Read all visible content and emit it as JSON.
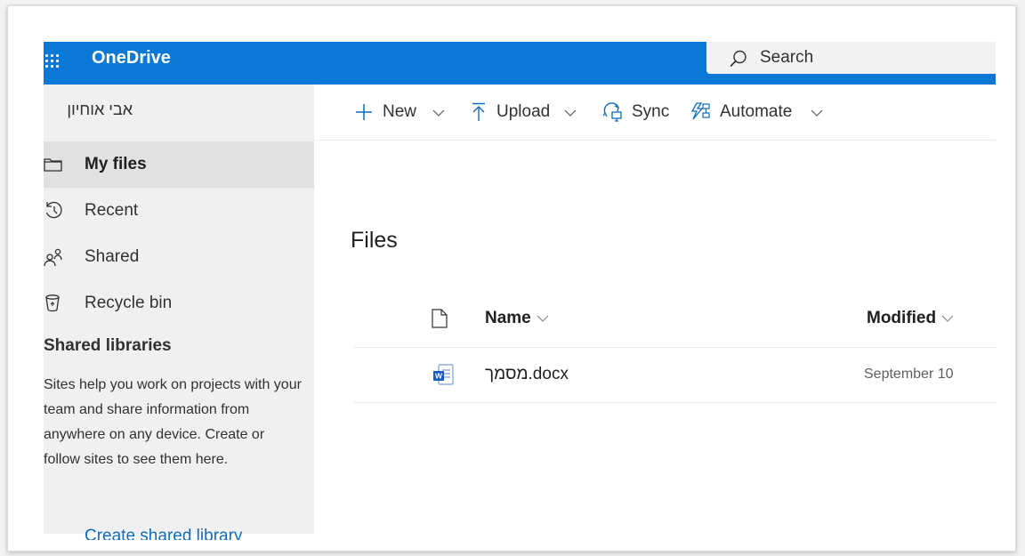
{
  "app": {
    "title": "OneDrive"
  },
  "search": {
    "placeholder": "Search"
  },
  "sidebar": {
    "user_name": "אבי אוחיון",
    "items": [
      {
        "label": "My files",
        "icon": "folder-icon",
        "selected": true
      },
      {
        "label": "Recent",
        "icon": "clock-icon",
        "selected": false
      },
      {
        "label": "Shared",
        "icon": "people-icon",
        "selected": false
      },
      {
        "label": "Recycle bin",
        "icon": "recycle-bin-icon",
        "selected": false
      }
    ],
    "shared_libraries": {
      "title": "Shared libraries",
      "description": "Sites help you work on projects with your team and share information from anywhere on any device. Create or follow sites to see them here.",
      "create_link": "Create shared library"
    }
  },
  "toolbar": {
    "new_label": "New",
    "upload_label": "Upload",
    "sync_label": "Sync",
    "automate_label": "Automate"
  },
  "main": {
    "heading": "Files",
    "columns": {
      "name": "Name",
      "modified": "Modified"
    },
    "files": [
      {
        "name": "מסמך.docx",
        "modified": "September 10",
        "icon": "word-document-icon"
      }
    ]
  },
  "colors": {
    "brand_blue": "#0a78d4",
    "nav_background": "#f0f0f0",
    "nav_selected": "#e1e1e1",
    "link": "#0f6cbd"
  }
}
